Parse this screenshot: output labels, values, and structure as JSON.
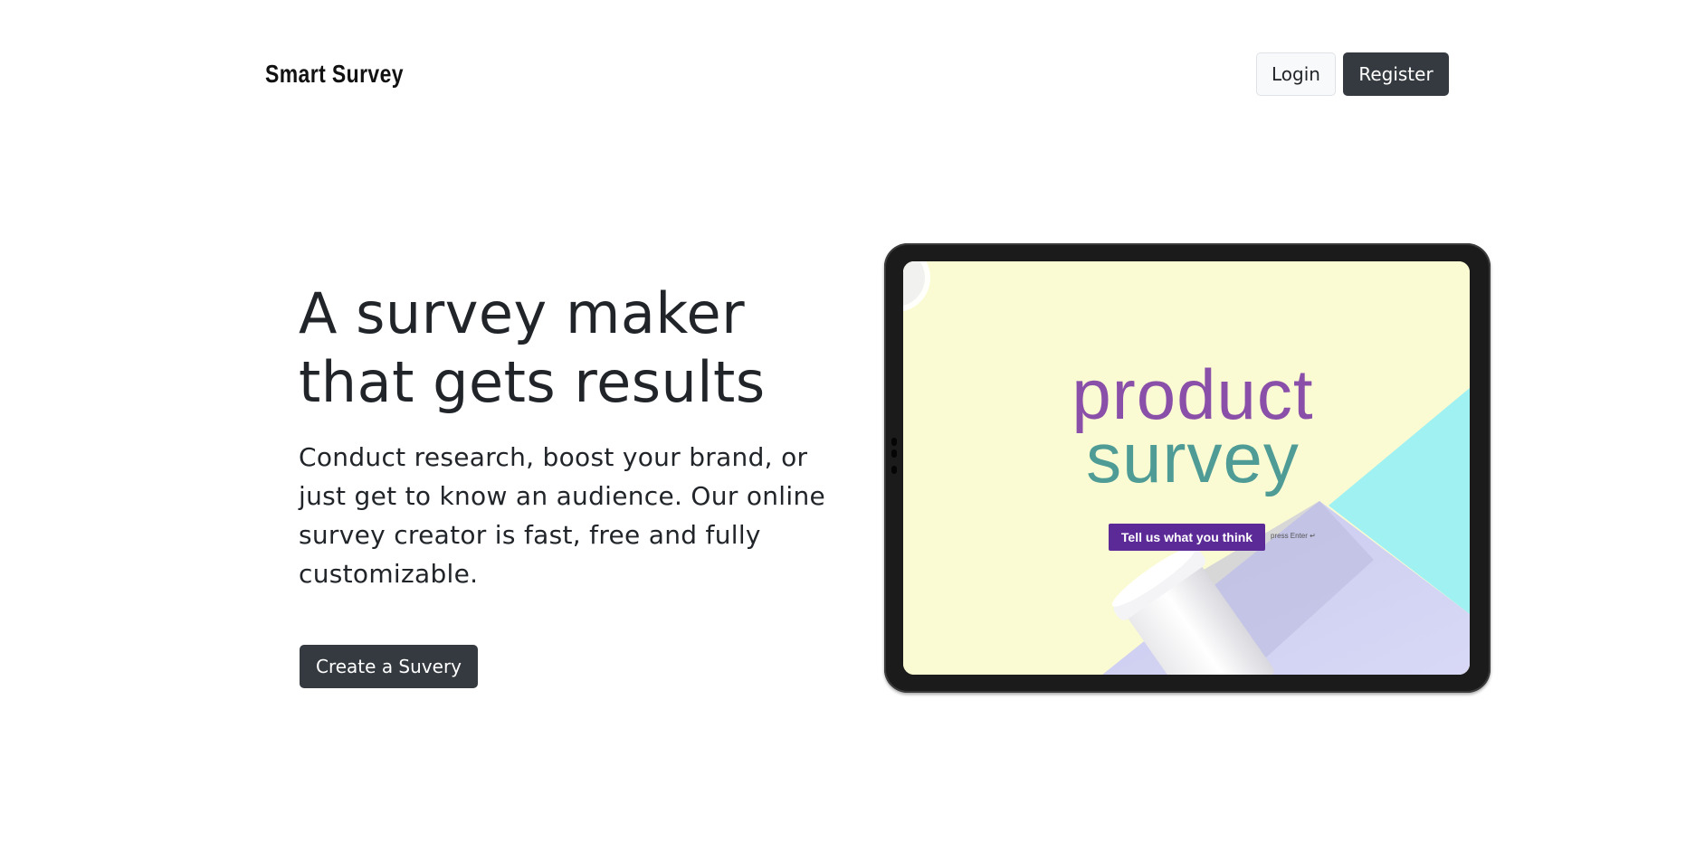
{
  "header": {
    "brand": "Smart Survey",
    "login_label": "Login",
    "register_label": "Register"
  },
  "hero": {
    "title": "A survey maker that gets results",
    "description": "Conduct research, boost your brand, or just get to know an audience. Our online survey creator is fast, free and fully customizable.",
    "cta_label": "Create a Suvery"
  },
  "mockup": {
    "title_line1": "product",
    "title_line2": "survey",
    "button_label": "Tell us what you think",
    "hint": "press Enter ↵"
  },
  "colors": {
    "dark_button": "#343a40",
    "light_button": "#f8f9fa",
    "text": "#212529",
    "mockup_purple": "#8a4fa8",
    "mockup_teal": "#4f9c97",
    "mockup_cta": "#5b2a97"
  }
}
